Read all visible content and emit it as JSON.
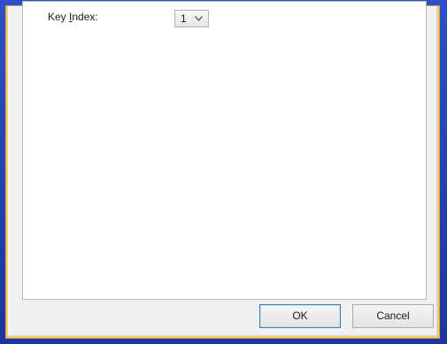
{
  "dialog": {
    "key_index_label_prefix": "Key ",
    "key_index_label_accel": "I",
    "key_index_label_suffix": "ndex:",
    "key_index_value": "1",
    "ok_label": "OK",
    "cancel_label": "Cancel"
  },
  "icons": {
    "dropdown": "chevron-down-icon"
  },
  "colors": {
    "frame": "#1d3aa6",
    "border_accent": "#f4c96b",
    "dialog_face": "#f0f0f0",
    "panel": "#ffffff",
    "default_button_border": "#3c7fb1"
  }
}
